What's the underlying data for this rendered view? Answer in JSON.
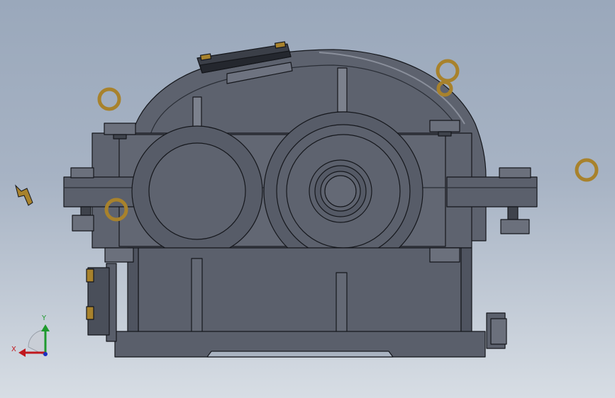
{
  "viewport": {
    "background_top": "#9aa8bb",
    "background_bottom": "#d7dde4"
  },
  "model": {
    "body_color": "#5b606c",
    "edge_color": "#15171c",
    "hardware_color": "#a8822c"
  },
  "triad": {
    "x_label": "X",
    "y_label": "Y",
    "x_color": "#c0181e",
    "y_color": "#1f9a2e",
    "z_color": "#1c2fc0"
  }
}
